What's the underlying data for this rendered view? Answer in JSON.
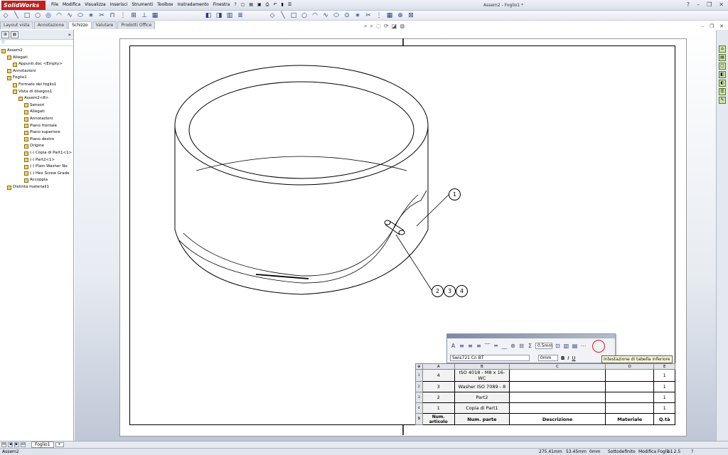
{
  "app": {
    "logo_text": "SolidWorks",
    "doc_title": "Assem2 - Foglio1 *"
  },
  "menu": [
    "File",
    "Modifica",
    "Visualizza",
    "Inserisci",
    "Strumenti",
    "Toolbox",
    "Instradamento",
    "Finestra",
    "?"
  ],
  "tabs": [
    {
      "label": "Layout vista",
      "active": false
    },
    {
      "label": "Annotazione",
      "active": false
    },
    {
      "label": "Schizzo",
      "active": true
    },
    {
      "label": "Valutare",
      "active": false
    },
    {
      "label": "Prodotti Office",
      "active": false
    }
  ],
  "feature_tree": [
    {
      "label": "Assem2",
      "indent": 0
    },
    {
      "label": "Allegati",
      "indent": 1
    },
    {
      "label": "Appunti.doc <Empty>",
      "indent": 2
    },
    {
      "label": "Annotazioni",
      "indent": 1
    },
    {
      "label": "Foglio1",
      "indent": 1
    },
    {
      "label": "Formato del foglio1",
      "indent": 2
    },
    {
      "label": "Vista di disegno1",
      "indent": 2
    },
    {
      "label": "Assem2<8>",
      "indent": 3
    },
    {
      "label": "Sensori",
      "indent": 4
    },
    {
      "label": "Allegati",
      "indent": 4
    },
    {
      "label": "Annotazioni",
      "indent": 4
    },
    {
      "label": "Piano frontale",
      "indent": 4
    },
    {
      "label": "Piano superiore",
      "indent": 4
    },
    {
      "label": "Piano destro",
      "indent": 4
    },
    {
      "label": "Origine",
      "indent": 4
    },
    {
      "label": "(-) Copia di Part1<1>",
      "indent": 4
    },
    {
      "label": "(-) Part2<1>",
      "indent": 4
    },
    {
      "label": "(-) Plain Washer No",
      "indent": 4
    },
    {
      "label": "(-) Hex Screw Grade",
      "indent": 4
    },
    {
      "label": "Accoppia",
      "indent": 4
    },
    {
      "label": "Distinta materiali1",
      "indent": 1
    }
  ],
  "balloons": [
    "1",
    "2",
    "3",
    "4"
  ],
  "format_toolbar": {
    "font": "Swis721 Cn BT",
    "size": "0.5mm",
    "spacing": "0mm",
    "bold": "B",
    "italic": "I",
    "underline": "U"
  },
  "tooltip": "Intestazione di tabella inferiore",
  "bom": {
    "col_letters": [
      "A",
      "B",
      "C",
      "D",
      "E"
    ],
    "rows": [
      {
        "idx": "1",
        "num": "4",
        "part": "ISO 4018 - M8 x 16-WC",
        "desc": "",
        "mat": "",
        "qty": "1"
      },
      {
        "idx": "2",
        "num": "3",
        "part": "Washer ISO 7089 - 8",
        "desc": "",
        "mat": "",
        "qty": "1"
      },
      {
        "idx": "3",
        "num": "2",
        "part": "Part2",
        "desc": "",
        "mat": "",
        "qty": "1"
      },
      {
        "idx": "4",
        "num": "1",
        "part": "Copia di Part1",
        "desc": "",
        "mat": "",
        "qty": "1"
      }
    ],
    "footer": {
      "idx": "5",
      "num": "Num. articolo",
      "part": "Num. parte",
      "desc": "Descrizione",
      "mat": "Materiale",
      "qty": "Q.tà"
    }
  },
  "bottom": {
    "sheet_tab": "Foglio1"
  },
  "status": {
    "left": "Assem2",
    "x": "275.41mm",
    "y": "53.45mm",
    "z": "0mm",
    "state": "Sottodefinito",
    "editing": "Modifica Foglio1",
    "scale": "1 : 2.5"
  }
}
